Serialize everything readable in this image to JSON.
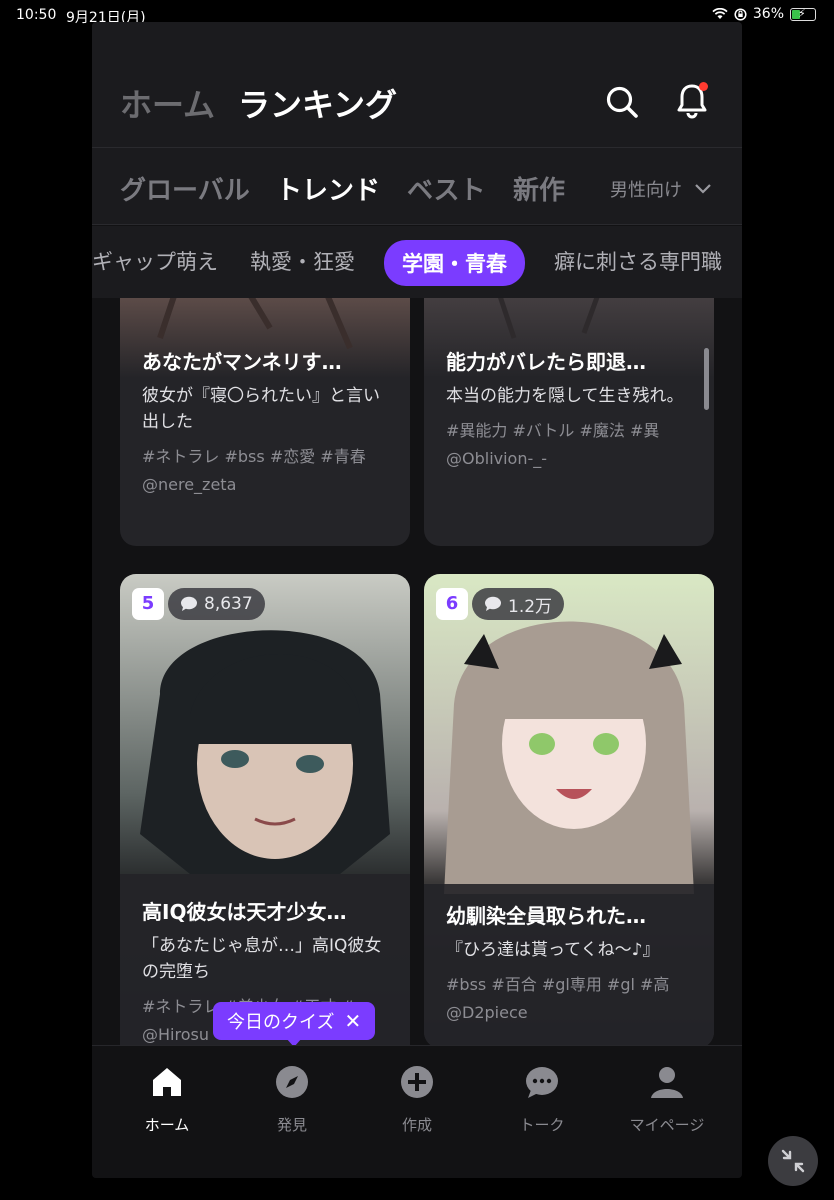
{
  "status": {
    "time": "10:50",
    "date": "9月21日(月)",
    "battery": "36%",
    "battery_level": 0.36
  },
  "header": {
    "home_label": "ホーム",
    "ranking_label": "ランキング"
  },
  "tabs": [
    {
      "label": "グローバル",
      "active": false
    },
    {
      "label": "トレンド",
      "active": true
    },
    {
      "label": "ベスト",
      "active": false
    },
    {
      "label": "新作",
      "active": false
    }
  ],
  "gender_select": {
    "value": "男性向け"
  },
  "genres": [
    {
      "label": "ギャップ萌え",
      "active": false
    },
    {
      "label": "執愛・狂愛",
      "active": false
    },
    {
      "label": "学園・青春",
      "active": true
    },
    {
      "label": "癖に刺さる専門職",
      "active": false
    }
  ],
  "cards": [
    {
      "title": "あなたがマンネリす…",
      "desc": "彼女が『寝〇られたい』と言い出した",
      "tags": "#ネトラレ #bss #恋愛 #青春",
      "author": "@nere_zeta"
    },
    {
      "title": "能力がバレたら即退…",
      "desc": "本当の能力を隠して生き残れ。",
      "tags": "#異能力 #バトル #魔法 #異",
      "author": "@Oblivion-_-"
    },
    {
      "rank": "5",
      "comments": "8,637",
      "title": "高IQ彼女は天才少女…",
      "desc": "「あなたじゃ息が…」高IQ彼女の完堕ち",
      "tags": "#ネトラレ #美少女 #天才 #",
      "author": "@Hirosu"
    },
    {
      "rank": "6",
      "comments": "1.2万",
      "title": "幼馴染全員取られた…",
      "desc": "『ひろ達は貰ってくね〜♪』",
      "tags": "#bss #百合 #gl専用 #gl #高",
      "author": "@D2piece"
    }
  ],
  "quiz_tip": {
    "label": "今日のクイズ"
  },
  "bottom_nav": [
    {
      "label": "ホーム",
      "icon": "home-icon",
      "active": true
    },
    {
      "label": "発見",
      "icon": "compass-icon",
      "active": false
    },
    {
      "label": "作成",
      "icon": "plus-circle-icon",
      "active": false
    },
    {
      "label": "トーク",
      "icon": "chat-bubble-icon",
      "active": false
    },
    {
      "label": "マイページ",
      "icon": "person-icon",
      "active": false
    }
  ],
  "colors": {
    "accent": "#7b3cff",
    "background": "#121214",
    "card": "#242428"
  }
}
